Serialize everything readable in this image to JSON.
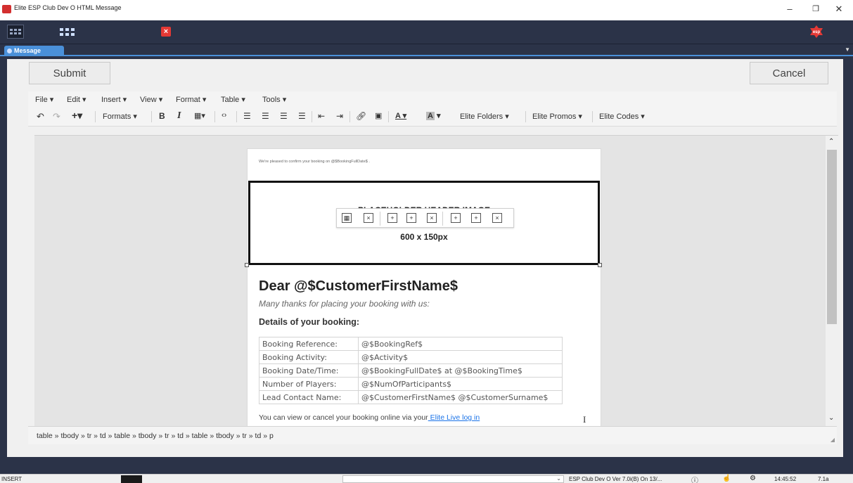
{
  "window": {
    "title": "Elite ESP Club Dev O HTML  Message",
    "controls": [
      "minimize",
      "maximize",
      "close"
    ]
  },
  "app_toolbar": {
    "icons": [
      "app-grid-icon",
      "dots-grid-icon",
      "close-x-icon",
      "esp-logo-icon"
    ],
    "logo_text": "esp"
  },
  "tab": {
    "label": "Message"
  },
  "actions": {
    "submit_label": "Submit",
    "cancel_label": "Cancel"
  },
  "menubar": {
    "items": [
      "File ▾",
      "Edit ▾",
      "Insert ▾",
      "View ▾",
      "Format ▾",
      "Table ▾",
      "Tools ▾"
    ]
  },
  "toolbar": {
    "formats_label": "Formats ▾",
    "bold_label": "B",
    "italic_label": "I",
    "elite_folders": "Elite Folders ▾",
    "elite_promos": "Elite Promos ▾",
    "elite_codes": "Elite Codes ▾"
  },
  "email": {
    "confirm_line": "We're pleased to confirm your booking on @$BookingFullDate$ .",
    "header_title": "PLACEHOLDER HEADER IMAGE",
    "header_size": "600 x 150px",
    "dear": "Dear @$CustomerFirstName$",
    "thanks": "Many thanks for placing your booking with us:",
    "details_heading": "Details of your booking:",
    "booking_rows": [
      {
        "label": "Booking Reference:",
        "value": "@$BookingRef$"
      },
      {
        "label": "Booking Activity:",
        "value": "@$Activity$"
      },
      {
        "label": "Booking Date/Time:",
        "value": "@$BookingFullDate$ at @$BookingTime$"
      },
      {
        "label": "Number of Players:",
        "value": "@$NumOfParticipants$"
      },
      {
        "label": "Lead Contact Name:",
        "value": "@$CustomerFirstName$ @$CustomerSurname$"
      }
    ],
    "view_text": "You can view or cancel your booking online via your",
    "view_link": " Elite Live log in"
  },
  "status_path": "table » tbody » tr » td » table » tbody » tr » td » table » tbody » tr » td » p",
  "bottom_bar": {
    "mode": "INSERT",
    "version": "ESP Club Dev O Ver 7.0i(B) On 13/...",
    "time": "14:45:52",
    "build": "7.1a"
  },
  "colors": {
    "frame": "#2b3348",
    "tab_accent": "#4a90d9",
    "link": "#1a73e8",
    "close_red": "#e53935"
  }
}
